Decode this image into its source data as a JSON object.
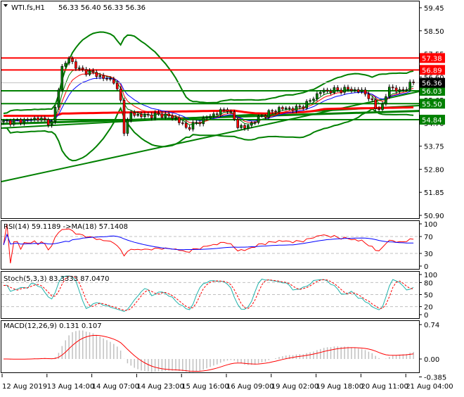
{
  "chart_data": {
    "type": "candlestick",
    "symbol_header": "WTI.fs,H1",
    "ohlc_header": "56.33 56.40 56.33 56.36",
    "current_price": "56.36",
    "price_axis": {
      "ticks": [
        "59.45",
        "58.50",
        "57.55",
        "56.60",
        "55.65",
        "54.70",
        "53.75",
        "52.80",
        "51.85",
        "50.90"
      ],
      "ylim": [
        50.9,
        59.45
      ]
    },
    "close_keypoints": [
      [
        0,
        54.75
      ],
      [
        5,
        54.8
      ],
      [
        10,
        54.9
      ],
      [
        14,
        54.7
      ],
      [
        15,
        55.3
      ],
      [
        17,
        57.0
      ],
      [
        19,
        57.35
      ],
      [
        22,
        56.9
      ],
      [
        26,
        56.75
      ],
      [
        30,
        56.5
      ],
      [
        32,
        56.45
      ],
      [
        34,
        55.6
      ],
      [
        35,
        54.4
      ],
      [
        37,
        55.1
      ],
      [
        40,
        55.0
      ],
      [
        46,
        55.05
      ],
      [
        50,
        54.9
      ],
      [
        53,
        54.5
      ],
      [
        56,
        54.7
      ],
      [
        60,
        55.0
      ],
      [
        65,
        55.3
      ],
      [
        68,
        54.6
      ],
      [
        70,
        54.5
      ],
      [
        75,
        55.0
      ],
      [
        80,
        55.3
      ],
      [
        85,
        55.3
      ],
      [
        88,
        55.5
      ],
      [
        92,
        56.0
      ],
      [
        96,
        56.05
      ],
      [
        100,
        56.1
      ],
      [
        104,
        56.0
      ],
      [
        106,
        55.8
      ],
      [
        108,
        55.3
      ],
      [
        110,
        55.4
      ],
      [
        112,
        56.2
      ],
      [
        115,
        56.0
      ],
      [
        119,
        56.36
      ]
    ],
    "bars": 120,
    "levels": [
      {
        "value": "57.38",
        "color": "#ff0000"
      },
      {
        "value": "56.89",
        "color": "#ff0000"
      },
      {
        "value": "56.03",
        "color": "#008000"
      },
      {
        "value": "55.50",
        "color": "#008000"
      },
      {
        "value": "54.84",
        "color": "#008000"
      }
    ],
    "x_labels": [
      "12 Aug 2019",
      "13 Aug 14:00",
      "14 Aug 07:00",
      "14 Aug 23:00",
      "15 Aug 16:00",
      "16 Aug 09:00",
      "19 Aug 02:00",
      "19 Aug 18:00",
      "20 Aug 11:00",
      "21 Aug 04:00"
    ],
    "rsi": {
      "label": "RSI(14) 59.1189  ->MA(18) 57.1408",
      "ticks": [
        "100",
        "70",
        "30",
        "0"
      ],
      "levels": [
        70,
        30
      ]
    },
    "stoch": {
      "label": "Stoch(5,3,3) 83.3333 87.0470",
      "ticks": [
        "100",
        "80",
        "50",
        "20",
        "0"
      ],
      "levels": [
        80,
        50,
        20
      ]
    },
    "macd": {
      "label": "MACD(12,26,9) 0.131 0.107",
      "ticks": [
        "0.74",
        "0.00",
        "-0.385"
      ],
      "ylim": [
        -0.385,
        0.74
      ]
    },
    "colors": {
      "bull": "#008000",
      "bear": "#ff0000",
      "band": "#008000",
      "level_red": "#ff0000",
      "level_green": "#008000"
    }
  }
}
